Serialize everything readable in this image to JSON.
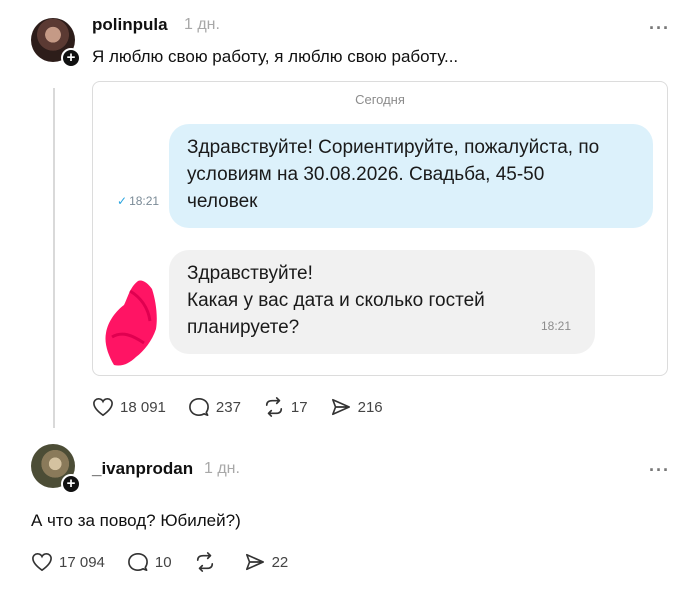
{
  "post1": {
    "username": "polinpula",
    "time": "1 дн.",
    "more": "···",
    "text": "Я люблю свою работу, я люблю свою работу...",
    "chat": {
      "date": "Сегодня",
      "outgoing": {
        "lines": [
          "Здравствуйте! Сориентируйте, пожалуйста, по",
          "условиям на 30.08.2026. Свадьба, 45-50",
          "человек"
        ],
        "time": "18:21"
      },
      "incoming": {
        "lines": [
          "Здравствуйте!",
          "Какая у вас дата и сколько гостей",
          "планируете?"
        ],
        "time": "18:21"
      }
    },
    "stats": {
      "likes": "18 091",
      "comments": "237",
      "reposts": "17",
      "shares": "216"
    }
  },
  "post2": {
    "username": "_ivanprodan",
    "time": "1 дн.",
    "more": "···",
    "text": "А что за повод? Юбилей?)",
    "stats": {
      "likes": "17 094",
      "comments": "10",
      "reposts": "",
      "shares": "22"
    }
  },
  "colors": {
    "outgoing_bubble": "#dcf1fb",
    "incoming_bubble": "#f1f1f1",
    "redaction": "#ff1464",
    "check": "#2aa5e0"
  },
  "icons": [
    "heart-icon",
    "comment-icon",
    "repost-icon",
    "send-icon",
    "plus-icon",
    "more-icon",
    "check-icon"
  ]
}
